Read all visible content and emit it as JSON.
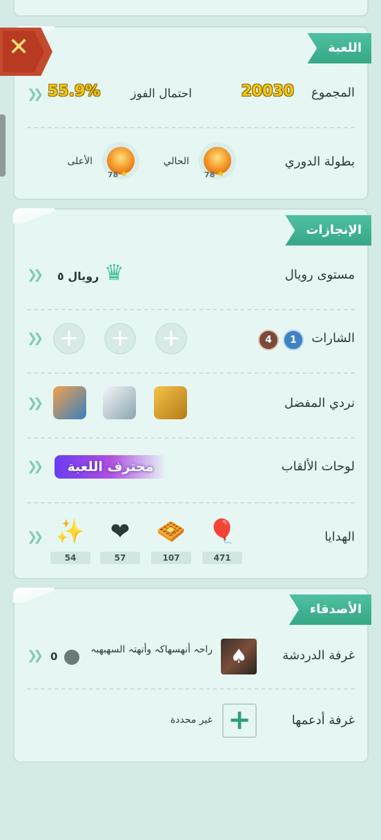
{
  "game": {
    "title": "اللعبة",
    "total_label": "المجموع",
    "total_value": "20030",
    "win_label": "احتمال الفوز",
    "win_value": "55.9%",
    "league_label": "بطولة الدوري",
    "current_label": "الحالي",
    "highest_label": "الأعلى",
    "current_level": "78",
    "highest_level": "78"
  },
  "achievements": {
    "title": "الإنجازات",
    "royal_label": "مستوى رويال",
    "royal_value": "رويال ٥",
    "badges_label": "الشارات",
    "badge_1": "1",
    "badge_2": "4",
    "dice_label": "نردي المفضل",
    "titles_label": "لوحات الألقاب",
    "title_badge": "محترف اللعبة",
    "gifts_label": "الهدايا",
    "gifts": [
      {
        "icon": "balloons-icon",
        "count": "471"
      },
      {
        "icon": "waffle-icon",
        "count": "107"
      },
      {
        "icon": "heart-icon",
        "count": "57"
      },
      {
        "icon": "sparkle-icon",
        "count": "54"
      }
    ]
  },
  "friends": {
    "title": "الأصدقاء",
    "chat_label": "غرفة الدردشة",
    "chat_text": "راحہ أنهسهاکہ وأنهتہ السهبهبہ",
    "chat_members": "0",
    "support_label": "غرفة أدعمها",
    "support_value": "غير محددة"
  },
  "colors": {
    "accent": "#3fb393",
    "background": "#d3eae6",
    "card": "#e6f7f3",
    "gold": "#f2c51a"
  }
}
